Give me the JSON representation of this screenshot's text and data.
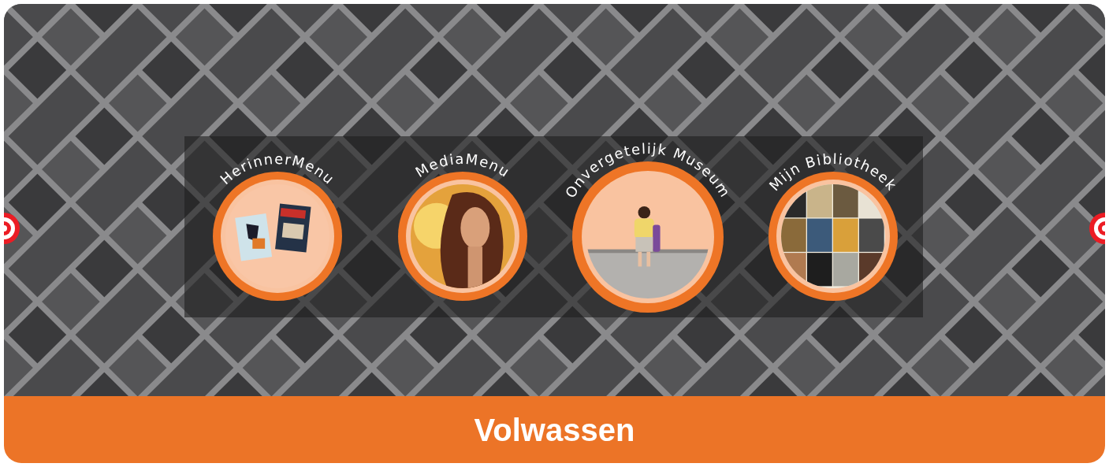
{
  "menu_items": [
    {
      "label": "HerinnerMenu",
      "featured": false
    },
    {
      "label": "MediaMenu",
      "featured": false
    },
    {
      "label": "Onvergetelijk Museum",
      "featured": true
    },
    {
      "label": "Mijn Bibliotheek",
      "featured": false
    }
  ],
  "footer": {
    "title": "Volwassen"
  }
}
